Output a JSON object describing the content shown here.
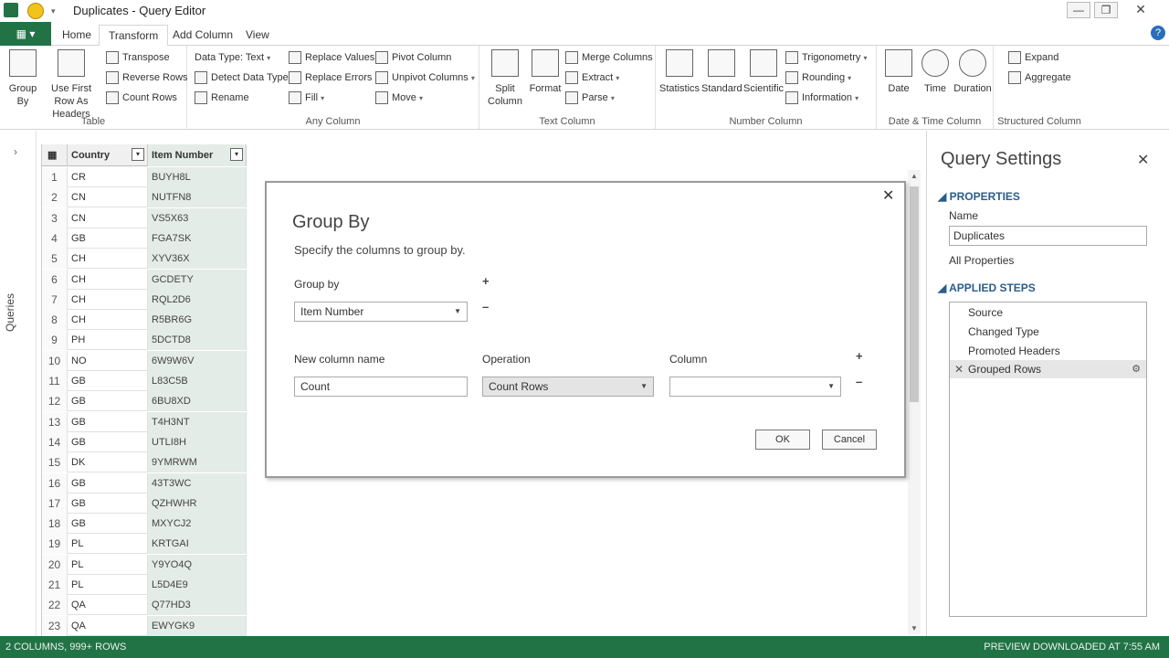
{
  "window": {
    "title": "Duplicates - Query Editor",
    "minimize": "—",
    "restore": "❐",
    "close": "✕"
  },
  "tabs": {
    "file": "▦ ▾",
    "items": [
      "Home",
      "Transform",
      "Add Column",
      "View"
    ],
    "active": "Transform"
  },
  "ribbon": {
    "table": {
      "label": "Table",
      "group_by": "Group By",
      "use_first_row": "Use First Row As Headers",
      "transpose": "Transpose",
      "reverse_rows": "Reverse Rows",
      "count_rows": "Count Rows"
    },
    "any_column": {
      "label": "Any Column",
      "data_type": "Data Type: Text",
      "detect_data_type": "Detect Data Type",
      "rename": "Rename",
      "replace_values": "Replace Values",
      "replace_errors": "Replace Errors",
      "fill": "Fill",
      "pivot_column": "Pivot Column",
      "unpivot_columns": "Unpivot Columns",
      "move": "Move"
    },
    "text_column": {
      "label": "Text Column",
      "split_column": "Split Column",
      "format": "Format",
      "merge_columns": "Merge Columns",
      "extract": "Extract",
      "parse": "Parse"
    },
    "number_column": {
      "label": "Number Column",
      "statistics": "Statistics",
      "standard": "Standard",
      "scientific": "Scientific",
      "trigonometry": "Trigonometry",
      "rounding": "Rounding",
      "information": "Information"
    },
    "date_time_column": {
      "label": "Date & Time Column",
      "date": "Date",
      "time": "Time",
      "duration": "Duration"
    },
    "structured_column": {
      "label": "Structured Column",
      "expand": "Expand",
      "aggregate": "Aggregate"
    }
  },
  "queries_strip": {
    "label": "Queries"
  },
  "grid": {
    "columns": [
      "Country",
      "Item Number"
    ],
    "rows": [
      {
        "n": "1",
        "country": "CR",
        "item": "BUYH8L"
      },
      {
        "n": "2",
        "country": "CN",
        "item": "NUTFN8"
      },
      {
        "n": "3",
        "country": "CN",
        "item": "VS5X63"
      },
      {
        "n": "4",
        "country": "GB",
        "item": "FGA7SK"
      },
      {
        "n": "5",
        "country": "CH",
        "item": "XYV36X"
      },
      {
        "n": "6",
        "country": "CH",
        "item": "GCDETY"
      },
      {
        "n": "7",
        "country": "CH",
        "item": "RQL2D6"
      },
      {
        "n": "8",
        "country": "CH",
        "item": "R5BR6G"
      },
      {
        "n": "9",
        "country": "PH",
        "item": "5DCTD8"
      },
      {
        "n": "10",
        "country": "NO",
        "item": "6W9W6V"
      },
      {
        "n": "11",
        "country": "GB",
        "item": "L83C5B"
      },
      {
        "n": "12",
        "country": "GB",
        "item": "6BU8XD"
      },
      {
        "n": "13",
        "country": "GB",
        "item": "T4H3NT"
      },
      {
        "n": "14",
        "country": "GB",
        "item": "UTLI8H"
      },
      {
        "n": "15",
        "country": "DK",
        "item": "9YMRWM"
      },
      {
        "n": "16",
        "country": "GB",
        "item": "43T3WC"
      },
      {
        "n": "17",
        "country": "GB",
        "item": "QZHWHR"
      },
      {
        "n": "18",
        "country": "GB",
        "item": "MXYCJ2"
      },
      {
        "n": "19",
        "country": "PL",
        "item": "KRTGAI"
      },
      {
        "n": "20",
        "country": "PL",
        "item": "Y9YO4Q"
      },
      {
        "n": "21",
        "country": "PL",
        "item": "L5D4E9"
      },
      {
        "n": "22",
        "country": "QA",
        "item": "Q77HD3"
      },
      {
        "n": "23",
        "country": "QA",
        "item": "EWYGK9"
      }
    ]
  },
  "dialog": {
    "title": "Group By",
    "subtitle": "Specify the columns to group by.",
    "group_by_label": "Group by",
    "group_by_value": "Item Number",
    "new_column_label": "New column name",
    "new_column_value": "Count",
    "operation_label": "Operation",
    "operation_value": "Count Rows",
    "column_label": "Column",
    "column_value": "",
    "ok": "OK",
    "cancel": "Cancel",
    "close": "✕",
    "plus": "+",
    "minus": "–"
  },
  "query_settings": {
    "title": "Query Settings",
    "close": "✕",
    "properties_header": "PROPERTIES",
    "name_label": "Name",
    "name_value": "Duplicates",
    "all_properties": "All Properties",
    "applied_steps_header": "APPLIED STEPS",
    "steps": [
      "Source",
      "Changed Type",
      "Promoted Headers",
      "Grouped Rows"
    ],
    "selected_step": "Grouped Rows"
  },
  "statusbar": {
    "left": "2 COLUMNS, 999+ ROWS",
    "right": "PREVIEW DOWNLOADED AT 7:55 AM"
  },
  "colors": {
    "accent": "#217346",
    "section_header": "#2a5d8c",
    "selected_column": "#e3ece7"
  }
}
